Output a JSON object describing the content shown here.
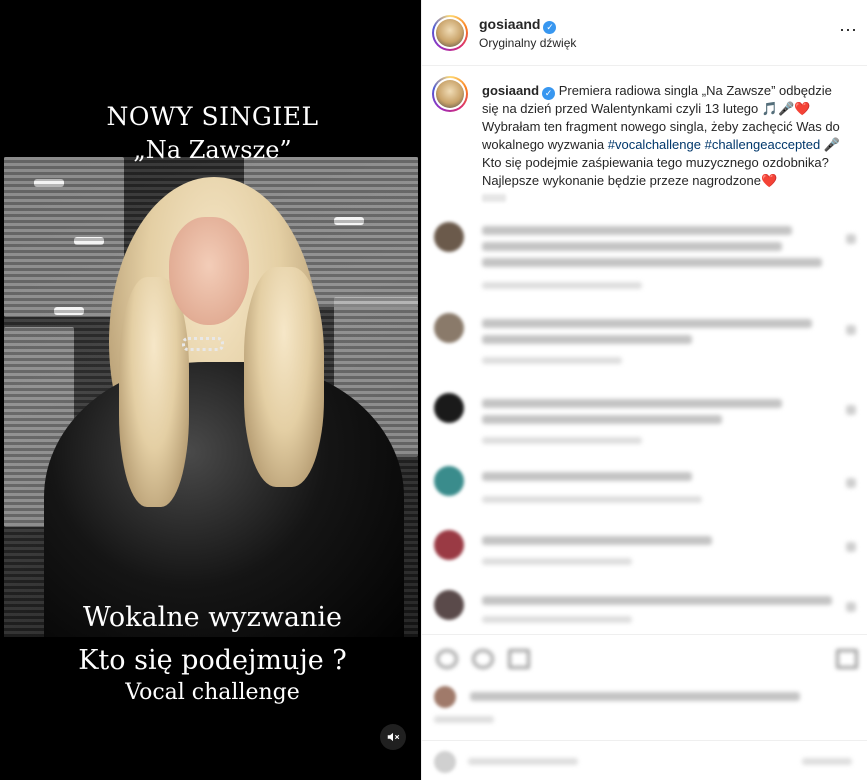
{
  "media": {
    "overlay_lines": [
      "NOWY SINGIEL",
      "„Na Zawsze”",
      "Wokalne wyzwanie",
      "Kto się podejmuje ?",
      "Vocal challenge"
    ],
    "mute_icon": "speaker-muted-icon"
  },
  "post": {
    "header": {
      "username": "gosiaand",
      "subtitle": "Oryginalny dźwięk",
      "more_icon": "⋯"
    },
    "caption": {
      "username": "gosiaand",
      "text_part1": "Premiera radiowa singla „Na Zawsze” odbędzie się na dzień przed Walentynkami czyli 13 lutego 🎵🎤❤️",
      "text_part2": "Wybrałam ten fragment nowego singla, żeby zachęcić Was do wokalnego wyzwania ",
      "hashtag1": "#vocalchallenge",
      "hashtag2": "#challengeaccepted",
      "text_part3": " 🎤 Kto się podejmie zaśpiewania tego muzycznego ozdobnika? Najlepsze wykonanie będzie przeze nagrodzone❤️"
    }
  },
  "colors": {
    "verified": "#3897f0",
    "hashtag": "#00376b",
    "story_ring": [
      "#feda75",
      "#fa7e1e",
      "#d62976",
      "#962fbf",
      "#4f5bd5"
    ]
  }
}
